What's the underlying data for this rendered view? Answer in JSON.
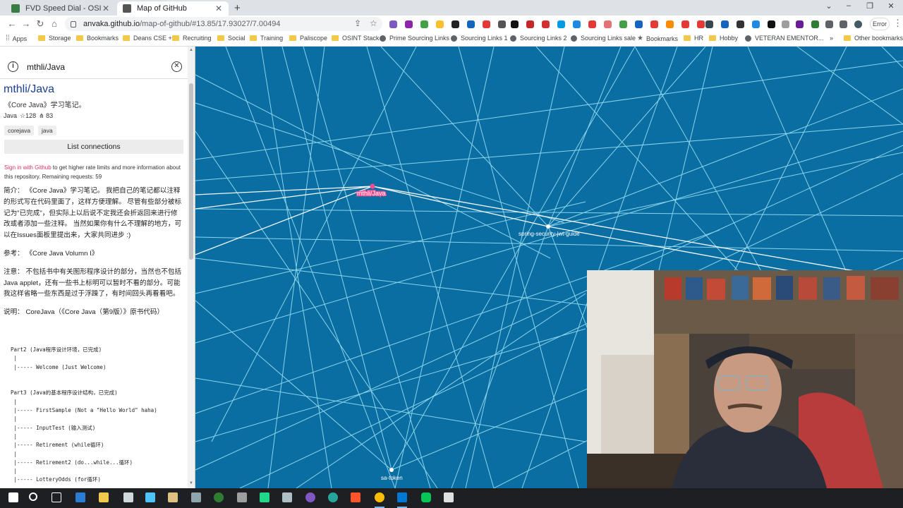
{
  "browser": {
    "tabs": [
      {
        "title": "FVD Speed Dial - OSINT",
        "active": false,
        "favicon_color": "#3a7d44"
      },
      {
        "title": "Map of GitHub",
        "active": true,
        "favicon_color": "#555555"
      }
    ],
    "new_tab": "+",
    "window_controls": {
      "minimize": "–",
      "restore": "❐",
      "close": "✕"
    },
    "url_host": "anvaka.github.io",
    "url_path": "/map-of-github/#13.85/17.93027/7.00494",
    "error_button": "Error"
  },
  "bookmarks": [
    {
      "label": "Apps",
      "kind": "apps"
    },
    {
      "label": "Storage",
      "kind": "folder"
    },
    {
      "label": "Bookmarks",
      "kind": "folder"
    },
    {
      "label": "Deans CSE +",
      "kind": "folder"
    },
    {
      "label": "Recruiting",
      "kind": "folder"
    },
    {
      "label": "Social",
      "kind": "folder"
    },
    {
      "label": "Training",
      "kind": "folder"
    },
    {
      "label": "Paliscope",
      "kind": "folder"
    },
    {
      "label": "OSINT Stack",
      "kind": "folder"
    },
    {
      "label": "Prime Sourcing Links",
      "kind": "globe"
    },
    {
      "label": "Sourcing Links 1",
      "kind": "globe"
    },
    {
      "label": "Sourcing Links 2",
      "kind": "globe"
    },
    {
      "label": "Sourcing Links sale",
      "kind": "globe"
    },
    {
      "label": "Bookmarks",
      "kind": "star"
    },
    {
      "label": "HR",
      "kind": "folder"
    },
    {
      "label": "Hobby",
      "kind": "folder"
    },
    {
      "label": "VETERAN EMENTOR...",
      "kind": "globe"
    },
    {
      "label": "»",
      "kind": "more"
    },
    {
      "label": "Other bookmarks",
      "kind": "folder"
    }
  ],
  "panel": {
    "search_value": "mthli/Java",
    "repo_name": "mthli/Java",
    "description": "《Core Java》学习笔记。",
    "language": "Java",
    "stars": "☆128",
    "forks": "⋔ 83",
    "tags": [
      "corejava",
      "java"
    ],
    "list_connections": "List connections",
    "signin_link": "Sign in with Github",
    "signin_rest": " to get higher rate limits and more information about this repository. Remaining requests: 59",
    "readme": [
      "简介： 《Core Java》学习笔记。 我把自己的笔记都以注释的形式写在代码里面了，这样方便理解。 尽管有些部分被标记为\"已完成\"，但实际上以后说不定我还会折返回来进行修改或者添加一些注释。 当然如果你有什么不理解的地方，可以在Issues面板里提出来，大家共同进步 :)",
      "参考： 《Core Java Volumn I》",
      "注意： 不包括书中有关图形程序设计的部分，当然也不包括Java applet，还有一些书上标明可以暂时不看的部分。可能我这样省略一些东西是过于浮躁了，有时间回头再看看吧。",
      "说明： CoreJava（《Core Java（第9版）》原书代码）"
    ],
    "code": "Part2 (Java程序设计环境，已完成)\n |\n |----- Welcome (Just Welcome)\n\n\nPart3 (Java的基本程序设计结构，已完成)\n |\n |----- FirstSample (Not a \"Hello World\" haha)\n |\n |----- InputTest (输入测试)\n |\n |----- Retirement (while循环)\n |\n |----- Retirement2 (do...while...循环)\n |\n |----- LotteryOdds (for循环)"
  },
  "map": {
    "labels": [
      {
        "text": "mthli/Java",
        "highlight": true
      },
      {
        "text": "spring-security-jwt-guide",
        "highlight": false
      },
      {
        "text": "sa-token",
        "highlight": false
      }
    ],
    "background": "#0b6ea3",
    "line_color": "#9fe6f7",
    "highlight_color": "#ff4d8f"
  },
  "taskbar": {
    "items": [
      "windows",
      "search",
      "task-view",
      "edge",
      "file-explorer",
      "mail",
      "files",
      "photos",
      "store",
      "maps",
      "pycharm",
      "calculator",
      "media",
      "edge-2",
      "brave",
      "chrome",
      "outlook",
      "line",
      "app"
    ]
  }
}
